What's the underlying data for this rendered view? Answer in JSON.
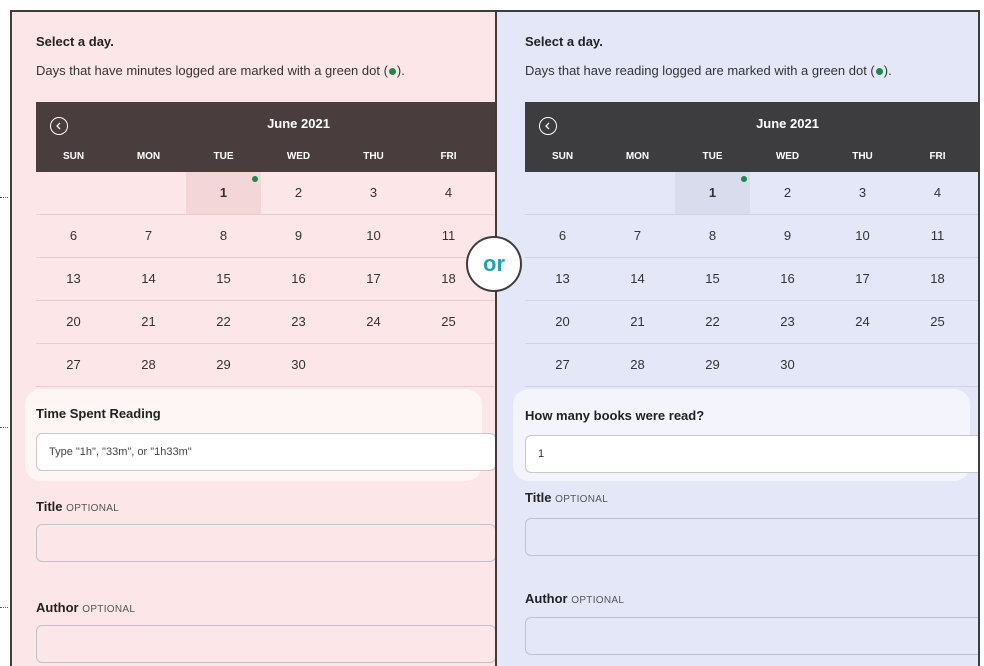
{
  "left": {
    "heading": "Select a day.",
    "subtext_before": "Days that have minutes logged are marked with a green dot (",
    "subtext_after": ").",
    "calendar": {
      "month": "June 2021",
      "weekdays": [
        "SUN",
        "MON",
        "TUE",
        "WED",
        "THU",
        "FRI"
      ],
      "weeks": [
        [
          "",
          "",
          "1",
          "2",
          "3",
          "4"
        ],
        [
          "6",
          "7",
          "8",
          "9",
          "10",
          "11"
        ],
        [
          "13",
          "14",
          "15",
          "16",
          "17",
          "18"
        ],
        [
          "20",
          "21",
          "22",
          "23",
          "24",
          "25"
        ],
        [
          "27",
          "28",
          "29",
          "30",
          "",
          ""
        ]
      ]
    },
    "field_label": "Time Spent Reading",
    "field_placeholder": "Type \"1h\", \"33m\", or \"1h33m\"",
    "title_label": "Title",
    "title_optional": "OPTIONAL",
    "author_label": "Author",
    "author_optional": "OPTIONAL"
  },
  "right": {
    "heading": "Select a day.",
    "subtext_before": "Days that have reading logged are marked with a green dot (",
    "subtext_after": ").",
    "calendar": {
      "month": "June 2021",
      "weekdays": [
        "SUN",
        "MON",
        "TUE",
        "WED",
        "THU",
        "FRI"
      ],
      "weeks": [
        [
          "",
          "",
          "1",
          "2",
          "3",
          "4"
        ],
        [
          "6",
          "7",
          "8",
          "9",
          "10",
          "11"
        ],
        [
          "13",
          "14",
          "15",
          "16",
          "17",
          "18"
        ],
        [
          "20",
          "21",
          "22",
          "23",
          "24",
          "25"
        ],
        [
          "27",
          "28",
          "29",
          "30",
          "",
          ""
        ]
      ]
    },
    "field_label": "How many books were read?",
    "field_value": "1",
    "title_label": "Title",
    "title_optional": "OPTIONAL",
    "author_label": "Author",
    "author_optional": "OPTIONAL"
  },
  "divider_text": "or",
  "accent_color": "#1fa3ad",
  "logged_dot_color": "#1a8a4a"
}
